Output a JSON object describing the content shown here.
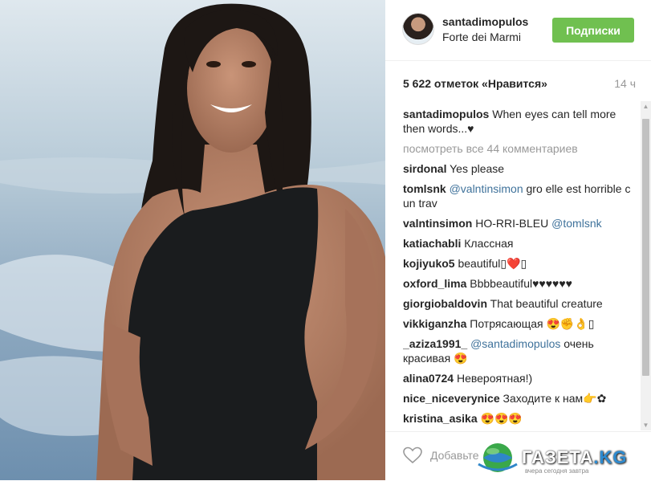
{
  "post": {
    "username": "santadimopulos",
    "location": "Forte dei Marmi",
    "follow_label": "Подписки",
    "likes": "5 622 отметок «Нравится»",
    "time": "14 ч",
    "caption_user": "santadimopulos",
    "caption_text": "When eyes can tell more then words...♥",
    "view_all": "посмотреть все 44 комментариев"
  },
  "comments": [
    {
      "user": "sirdonal",
      "mention": "",
      "text": "Yes please"
    },
    {
      "user": "tomlsnk",
      "mention": "@valntinsimon",
      "text": "gro elle est horrible c un trav"
    },
    {
      "user": "valntinsimon",
      "text": "HO-RRI-BLEU",
      "mention_after": "@tomlsnk"
    },
    {
      "user": "katiachabli",
      "mention": "",
      "text": "Классная"
    },
    {
      "user": "kojiyuko5",
      "mention": "",
      "text": "beautiful▯❤️▯"
    },
    {
      "user": "oxford_lima",
      "mention": "",
      "text": "Bbbbeautiful♥♥♥♥♥♥"
    },
    {
      "user": "giorgiobaldovin",
      "mention": "",
      "text": "That beautiful creature"
    },
    {
      "user": "vikkiganzha",
      "mention": "",
      "text": "Потрясающая 😍✊👌▯"
    },
    {
      "user": "_aziza1991_",
      "mention": "@santadimopulos",
      "text": "очень красивая 😍"
    },
    {
      "user": "alina0724",
      "mention": "",
      "text": "Невероятная!)"
    },
    {
      "user": "nice_niceverynice",
      "mention": "",
      "text": "Заходите к нам👉✿"
    },
    {
      "user": "kristina_asika",
      "mention": "",
      "text": "😍😍😍"
    }
  ],
  "footer": {
    "add_comment": "Добавьте",
    "logo_text": "ГАЗЕТА",
    "logo_tld": ".KG",
    "logo_sub": "вчера сегодня завтра"
  },
  "icons": {
    "heart": "heart-icon",
    "scroll_up": "arrow-up-icon",
    "scroll_down": "arrow-down-icon"
  },
  "colors": {
    "follow": "#70c050",
    "mention": "#3f729b",
    "muted": "#999999"
  }
}
